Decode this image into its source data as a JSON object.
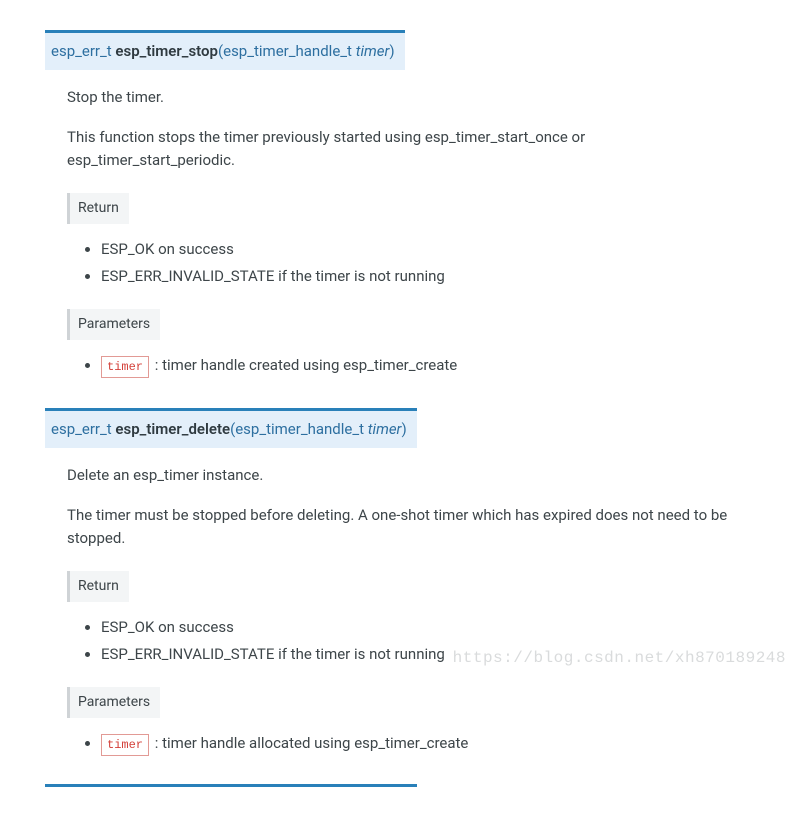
{
  "functions": [
    {
      "return_type": "esp_err_t",
      "name": "esp_timer_stop",
      "param_type": "esp_timer_handle_t",
      "param_name": "timer",
      "summary": "Stop the timer.",
      "desc": "This function stops the timer previously started using esp_timer_start_once or esp_timer_start_periodic.",
      "return_label": "Return",
      "returns": [
        "ESP_OK on success",
        "ESP_ERR_INVALID_STATE if the timer is not running"
      ],
      "params_label": "Parameters",
      "params": [
        {
          "code": "timer",
          "desc": ": timer handle created using esp_timer_create"
        }
      ]
    },
    {
      "return_type": "esp_err_t",
      "name": "esp_timer_delete",
      "param_type": "esp_timer_handle_t",
      "param_name": "timer",
      "summary": "Delete an esp_timer instance.",
      "desc": "The timer must be stopped before deleting. A one-shot timer which has expired does not need to be stopped.",
      "return_label": "Return",
      "returns": [
        "ESP_OK on success",
        "ESP_ERR_INVALID_STATE if the timer is not running"
      ],
      "params_label": "Parameters",
      "params": [
        {
          "code": "timer",
          "desc": ": timer handle allocated using esp_timer_create"
        }
      ]
    }
  ],
  "watermark": "https://blog.csdn.net/xh870189248"
}
